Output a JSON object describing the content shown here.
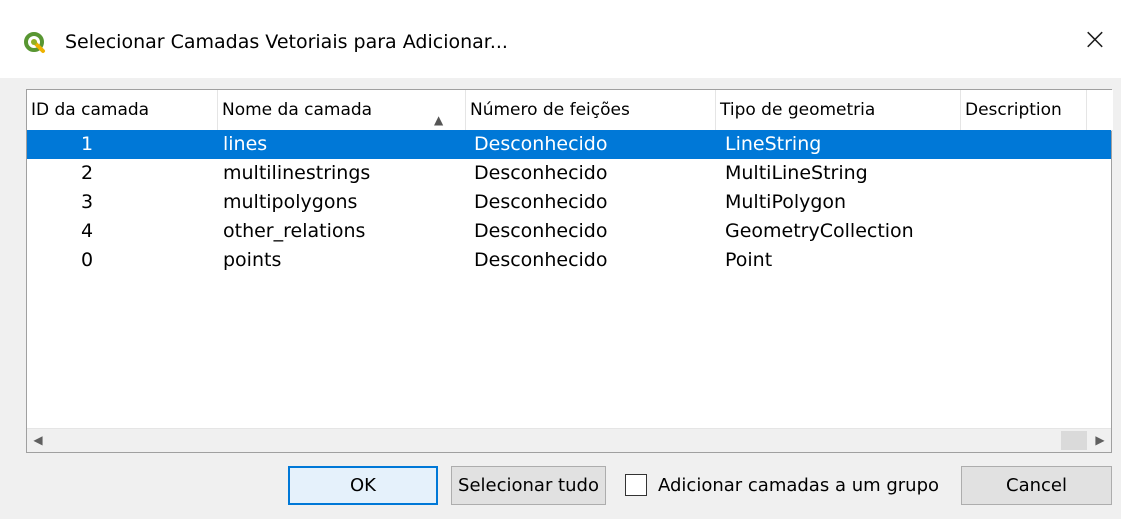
{
  "window": {
    "title": "Selecionar Camadas Vetoriais para Adicionar...",
    "close_glyph": "×",
    "icon": "qgis-logo-icon",
    "accent_color": "#0078d7"
  },
  "table": {
    "columns": [
      "ID da camada",
      "Nome da camada",
      "Número de feições",
      "Tipo de geometria",
      "Description"
    ],
    "sort_indicator": "▲",
    "rows": [
      {
        "id": "1",
        "name": "lines",
        "count": "Desconhecido",
        "type": "LineString",
        "selected": true
      },
      {
        "id": "2",
        "name": "multilinestrings",
        "count": "Desconhecido",
        "type": "MultiLineString",
        "selected": false
      },
      {
        "id": "3",
        "name": "multipolygons",
        "count": "Desconhecido",
        "type": "MultiPolygon",
        "selected": false
      },
      {
        "id": "4",
        "name": "other_relations",
        "count": "Desconhecido",
        "type": "GeometryCollection",
        "selected": false
      },
      {
        "id": "0",
        "name": "points",
        "count": "Desconhecido",
        "type": "Point",
        "selected": false
      }
    ],
    "scroll_left": "◀",
    "scroll_right": "▶"
  },
  "buttons": {
    "ok": "OK",
    "select_all": "Selecionar tudo",
    "add_to_group": "Adicionar camadas a um grupo",
    "add_to_group_checked": false,
    "cancel": "Cancel"
  }
}
